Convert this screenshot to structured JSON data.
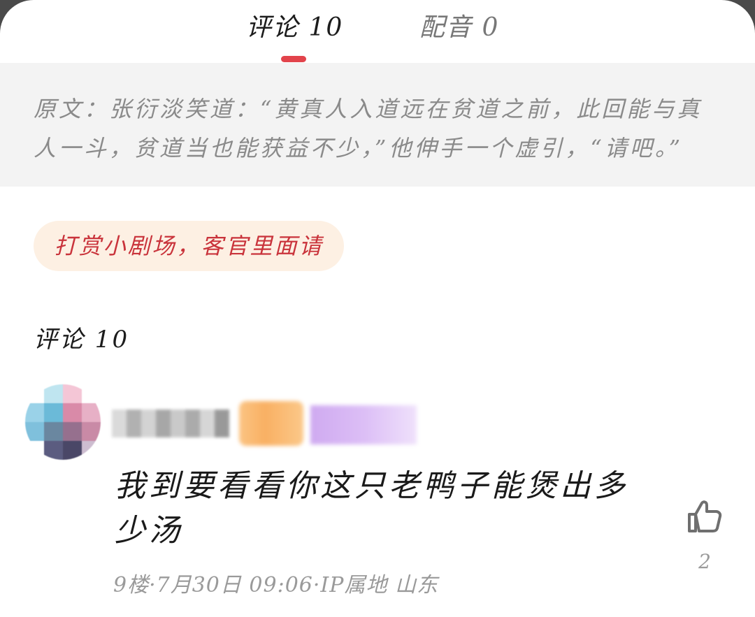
{
  "tabs": {
    "comments_label": "评论 10",
    "dubbing_label": "配音 0",
    "active": "comments",
    "indicator_color": "#e2434b"
  },
  "original": {
    "text": "原文：张衍淡笑道：“黄真人入道远在贫道之前，此回能与真人一斗，贫道当也能获益不少，”他伸手一个虚引，“请吧。”"
  },
  "reward": {
    "label": "打赏小剧场，客官里面请",
    "text_color": "#c9333b",
    "bg_color": "#fdf0e3"
  },
  "section": {
    "title": "评论 10"
  },
  "comments": [
    {
      "avatar_pixelated": true,
      "username_pixelated": true,
      "body": "我到要看看你这只老鸭子能煲出多少汤",
      "meta": "9楼·7月30日 09:06·IP属地 山东",
      "like_icon": "thumbs-up-icon",
      "like_count": "2"
    }
  ]
}
